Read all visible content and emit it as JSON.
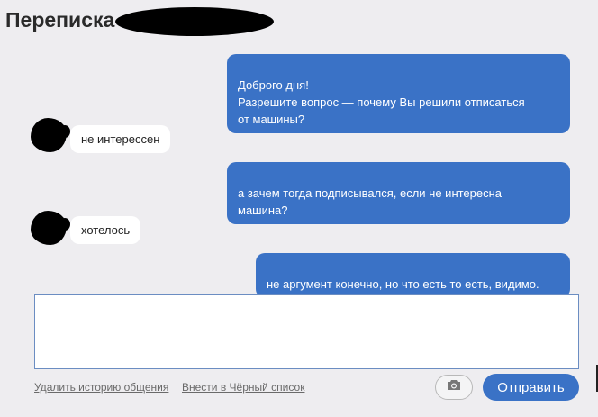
{
  "header": {
    "title": "Переписка с"
  },
  "messages": [
    {
      "direction": "out",
      "text": "Доброго дня!\nРазрешите вопрос — почему Вы решили отписаться\nот машины?"
    },
    {
      "direction": "in",
      "text": "не интерессен"
    },
    {
      "direction": "out",
      "text": "а зачем тогда подписывался, если не интересна\nмашина?"
    },
    {
      "direction": "in",
      "text": "хотелось"
    },
    {
      "direction": "out",
      "text": "не аргумент конечно, но что есть то есть, видимо."
    }
  ],
  "composer": {
    "value": ""
  },
  "footer": {
    "delete_history": "Удалить историю общения",
    "blacklist": "Внести в Чёрный список",
    "send_label": "Отправить"
  },
  "icons": {
    "attach_photo": "camera-icon"
  },
  "colors": {
    "outgoing_bubble": "#3a72c6",
    "incoming_bubble": "#ffffff",
    "background": "#eeedf0",
    "send_button": "#3a72c6"
  }
}
